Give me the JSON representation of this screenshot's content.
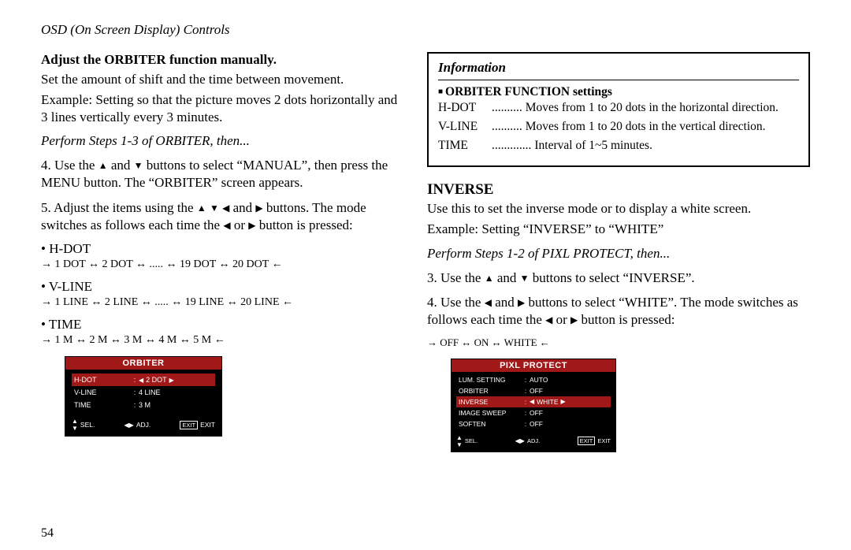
{
  "page": {
    "header": "OSD (On Screen Display) Controls",
    "page_number": "54"
  },
  "left": {
    "heading": "Adjust the ORBITER function manually.",
    "p1": "Set the amount of shift and the time between movement.",
    "p2": "Example: Setting so that the picture moves 2 dots horizontally and 3 lines vertically every 3 minutes.",
    "perform": "Perform Steps 1-3 of ORBITER, then...",
    "step4a": "4. Use the ",
    "step4b": " and ",
    "step4c": " buttons to select “MANUAL”, then press the MENU button. The “ORBITER” screen appears.",
    "step5a": "5. Adjust the items using the ",
    "step5b": " and ",
    "step5c": " buttons. The mode switches as follows each time the ",
    "step5d": " or ",
    "step5e": " button is pressed:",
    "hdot_label": "• H-DOT",
    "hdot_cycle": "→ 1 DOT ↔ 2 DOT ↔ ..... ↔ 19 DOT ↔ 20 DOT ←",
    "vline_label": "• V-LINE",
    "vline_cycle": "→ 1 LINE ↔ 2 LINE ↔ ..... ↔ 19 LINE ↔ 20 LINE ←",
    "time_label": "• TIME",
    "time_cycle": "→ 1 M ↔ 2 M ↔ 3 M ↔ 4 M ↔ 5 M ←"
  },
  "osd_orbiter": {
    "title": "ORBITER",
    "rows": [
      {
        "label": "H-DOT",
        "value": "2 DOT",
        "selected": true,
        "arrows": true
      },
      {
        "label": "V-LINE",
        "value": "4 LINE",
        "selected": false,
        "arrows": false
      },
      {
        "label": "TIME",
        "value": "3 M",
        "selected": false,
        "arrows": false
      }
    ],
    "footer": {
      "sel": "SEL.",
      "adj": "ADJ.",
      "exit_label": "EXIT",
      "exit_icon": "EXIT"
    }
  },
  "info_box": {
    "head": "Information",
    "settings_title": "ORBITER FUNCTION settings",
    "rows": [
      {
        "label": "H-DOT",
        "dots": "..........",
        "desc": "Moves from 1 to 20 dots in the horizontal direction."
      },
      {
        "label": "V-LINE",
        "dots": "..........",
        "desc": "Moves from 1 to 20 dots in the vertical direction."
      },
      {
        "label": "TIME",
        "dots": ".............",
        "desc": "Interval of 1~5 minutes."
      }
    ]
  },
  "right": {
    "title": "INVERSE",
    "p1": "Use this to set the inverse mode or to display a white screen.",
    "p2": "Example: Setting “INVERSE” to “WHITE”",
    "perform": "Perform Steps 1-2 of PIXL PROTECT, then...",
    "step3a": "3. Use the ",
    "step3b": " and ",
    "step3c": " buttons to select “INVERSE”.",
    "step4a": "4. Use the ",
    "step4b": " and ",
    "step4c": " buttons to select “WHITE”. The mode switches as follows each time the ",
    "step4d": " or ",
    "step4e": " button is pressed:",
    "cycle": "→ OFF ↔ ON ↔ WHITE ←"
  },
  "osd_pixl": {
    "title": "PIXL PROTECT",
    "rows": [
      {
        "label": "LUM. SETTING",
        "value": "AUTO",
        "selected": false,
        "arrows": false
      },
      {
        "label": "ORBITER",
        "value": "OFF",
        "selected": false,
        "arrows": false
      },
      {
        "label": "INVERSE",
        "value": "WHITE",
        "selected": true,
        "arrows": true
      },
      {
        "label": "IMAGE SWEEP",
        "value": "OFF",
        "selected": false,
        "arrows": false
      },
      {
        "label": "SOFTEN",
        "value": "OFF",
        "selected": false,
        "arrows": false
      }
    ],
    "footer": {
      "sel": "SEL.",
      "adj": "ADJ.",
      "exit_label": "EXIT",
      "exit_icon": "EXIT"
    }
  }
}
